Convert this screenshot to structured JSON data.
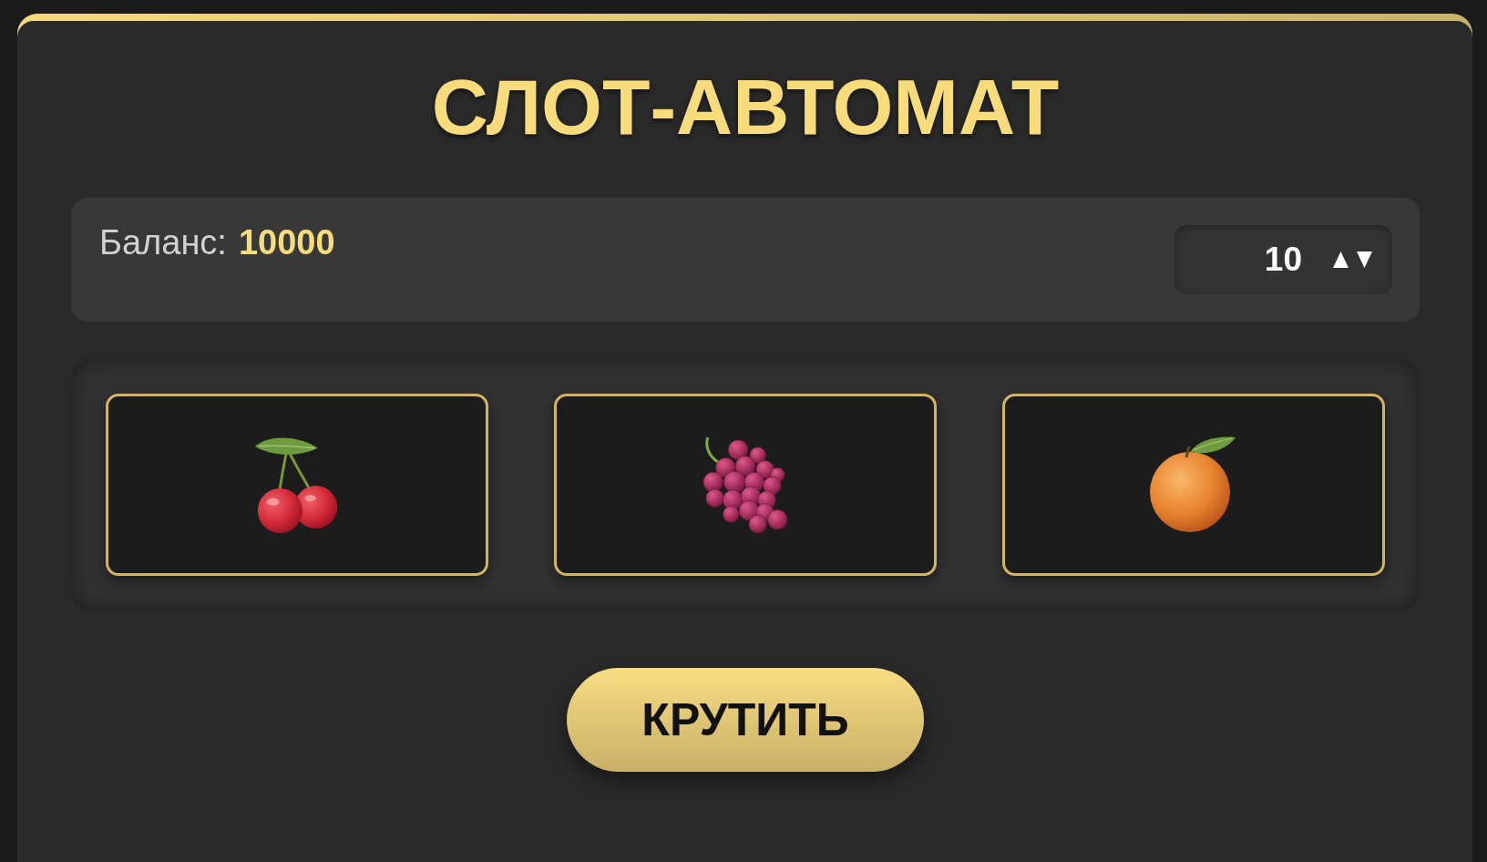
{
  "title": "СЛОТ-АВТОМАТ",
  "balance": {
    "label": "Баланс:",
    "value": "10000"
  },
  "bet": {
    "value": "10"
  },
  "reels": [
    {
      "kind": "cherry"
    },
    {
      "kind": "grapes"
    },
    {
      "kind": "orange"
    }
  ],
  "spin_button": {
    "label": "КРУТИТЬ"
  }
}
